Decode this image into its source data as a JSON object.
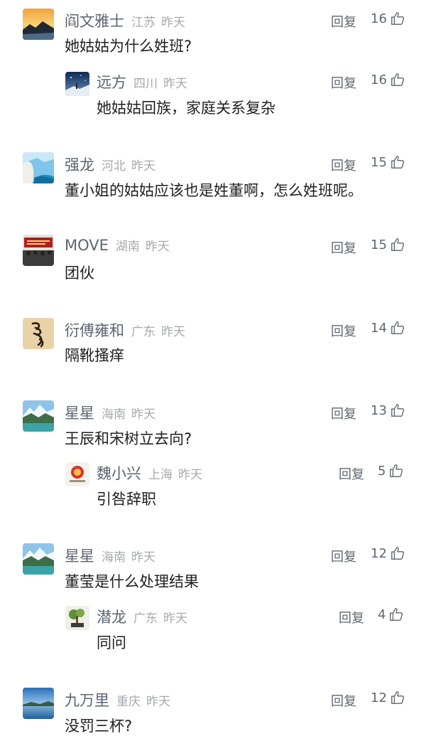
{
  "reply_label": "回复",
  "comments": [
    {
      "name": "阎文雅士",
      "location": "江苏",
      "time": "昨天",
      "likes": "16",
      "text": "她姑姑为什么姓班?",
      "avatar": "sunset-landscape"
    },
    {
      "name": "远方",
      "location": "四川",
      "time": "昨天",
      "likes": "16",
      "text": "她姑姑回族，家庭关系复杂",
      "avatar": "night-sky"
    },
    {
      "name": "强龙",
      "location": "河北",
      "time": "昨天",
      "likes": "15",
      "text": "董小姐的姑姑应该也是姓董啊，怎么姓班呢。",
      "avatar": "sea-cliff"
    },
    {
      "name": "MOVE",
      "location": "湖南",
      "time": "昨天",
      "likes": "15",
      "text": "团伙",
      "avatar": "red-banner-crowd"
    },
    {
      "name": "衍傅雍和",
      "location": "广东",
      "time": "昨天",
      "likes": "14",
      "text": "隔靴搔痒",
      "avatar": "calligraphy"
    },
    {
      "name": "星星",
      "location": "海南",
      "time": "昨天",
      "likes": "13",
      "text": "王辰和宋树立去向?",
      "avatar": "snow-mountain-lake"
    },
    {
      "name": "魏小兴",
      "location": "上海",
      "time": "昨天",
      "likes": "5",
      "text": "引咎辞职",
      "avatar": "logo-badge"
    },
    {
      "name": "星星",
      "location": "海南",
      "time": "昨天",
      "likes": "12",
      "text": "董莹是什么处理结果",
      "avatar": "snow-mountain-lake"
    },
    {
      "name": "潜龙",
      "location": "广东",
      "time": "昨天",
      "likes": "4",
      "text": "同问",
      "avatar": "bonsai-plant"
    },
    {
      "name": "九万里",
      "location": "重庆",
      "time": "昨天",
      "likes": "12",
      "text": "没罚三杯?",
      "avatar": "blue-lake"
    }
  ]
}
